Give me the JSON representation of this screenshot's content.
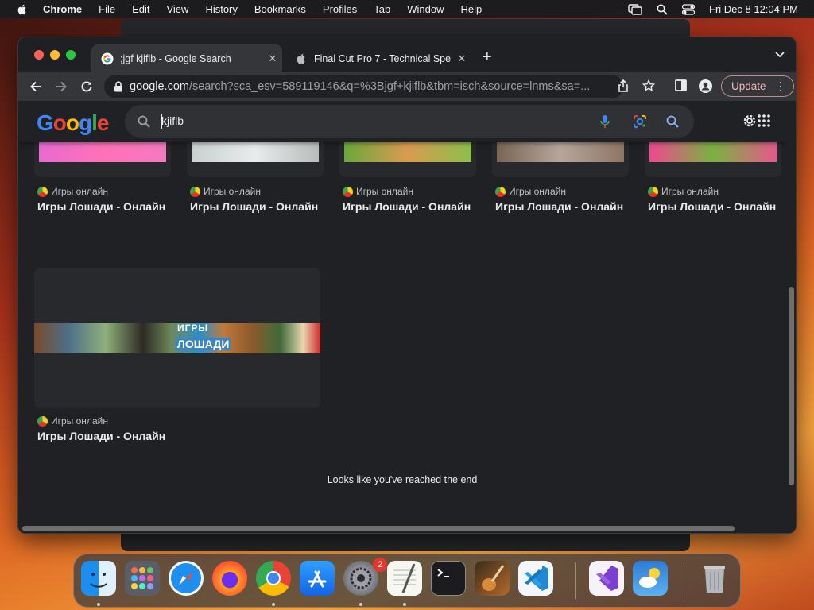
{
  "menubar": {
    "app": "Chrome",
    "items": [
      "File",
      "Edit",
      "View",
      "History",
      "Bookmarks",
      "Profiles",
      "Tab",
      "Window",
      "Help"
    ],
    "datetime": "Fri Dec 8  12:04 PM"
  },
  "tabs": [
    {
      "title": ";jgf kjiflb - Google Search",
      "favicon": "google-icon",
      "active": true
    },
    {
      "title": "Final Cut Pro 7 - Technical Spe",
      "favicon": "apple-icon",
      "active": false
    }
  ],
  "toolbar": {
    "url_host": "google.com",
    "url_path": "/search?sca_esv=589119146&q=%3Bjgf+kjiflb&tbm=isch&source=lnms&sa=...",
    "update_label": "Update"
  },
  "google": {
    "logo": "Google",
    "query": "kjiflb"
  },
  "results_row1": [
    {
      "source": "Игры онлайн",
      "title": "Игры Лошади - Онлайн"
    },
    {
      "source": "Игры онлайн",
      "title": "Игры Лошади - Онлайн"
    },
    {
      "source": "Игры онлайн",
      "title": "Игры Лошади - Онлайн"
    },
    {
      "source": "Игры онлайн",
      "title": "Игры Лошади - Онлайн"
    },
    {
      "source": "Игры онлайн",
      "title": "Игры Лошади - Онлайн"
    }
  ],
  "result_big": {
    "source": "Игры онлайн",
    "title": "Игры Лошади - Онлайн",
    "banner_text_1": "ИГРЫ",
    "banner_text_2": "ЛОШАДИ"
  },
  "end_message": "Looks like you've reached the end",
  "dock": {
    "apps": [
      "Finder",
      "Launchpad",
      "Safari",
      "Firefox",
      "Google Chrome",
      "App Store",
      "System Settings",
      "TextEdit",
      "Terminal",
      "Instruments",
      "Visual Studio Code",
      "Visual Studio",
      "Weather",
      "Trash"
    ],
    "settings_badge": "2"
  },
  "colors": {
    "accent": "#8ab4f8",
    "update_border": "#c58b89",
    "badge": "#e5372b"
  }
}
